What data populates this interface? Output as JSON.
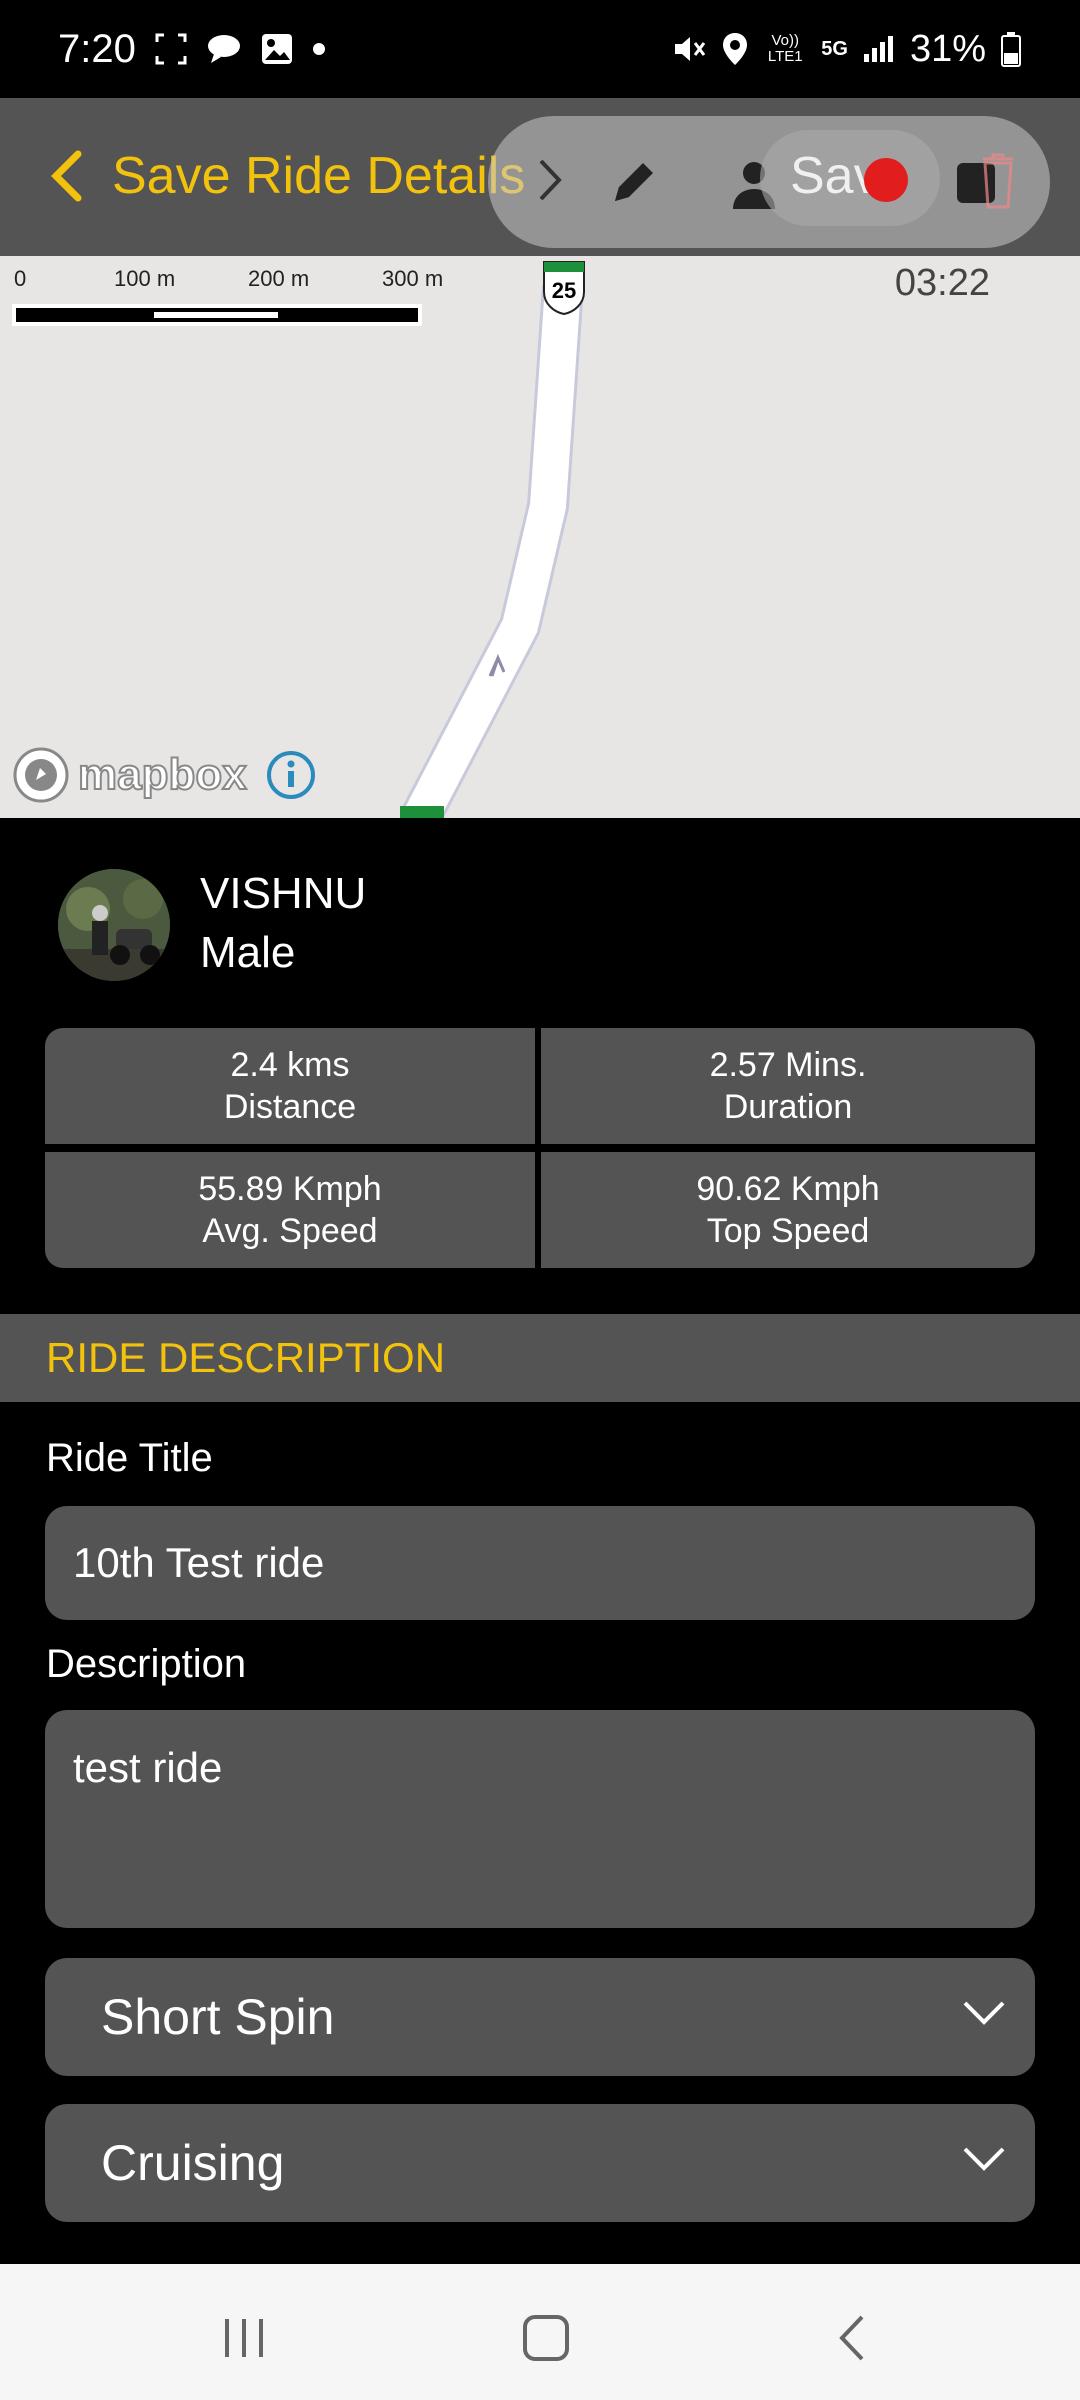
{
  "status_bar": {
    "time": "7:20",
    "battery": "31%",
    "network_badge": "5G",
    "volte_badge": "Vo)) LTE1"
  },
  "app_bar": {
    "title": "Save Ride Details",
    "overlay_save_label": "Save"
  },
  "map": {
    "scale_labels": [
      "0",
      "100 m",
      "200 m",
      "300 m"
    ],
    "timer": "03:22",
    "route_shield": "25",
    "attribution": "mapbox"
  },
  "profile": {
    "name": "VISHNU",
    "gender": "Male"
  },
  "stats": [
    {
      "value": "2.4 kms",
      "label": "Distance"
    },
    {
      "value": "2.57 Mins.",
      "label": "Duration"
    },
    {
      "value": "55.89 Kmph",
      "label": "Avg. Speed"
    },
    {
      "value": "90.62 Kmph",
      "label": "Top Speed"
    }
  ],
  "ride_description": {
    "header": "RIDE DESCRIPTION",
    "title_label": "Ride Title",
    "title_value": "10th Test ride",
    "description_label": "Description",
    "description_value": "test ride",
    "ride_type": "Short Spin",
    "ride_style": "Cruising"
  },
  "colors": {
    "accent": "#f3c20d",
    "panel": "#545454",
    "background": "#000000"
  }
}
